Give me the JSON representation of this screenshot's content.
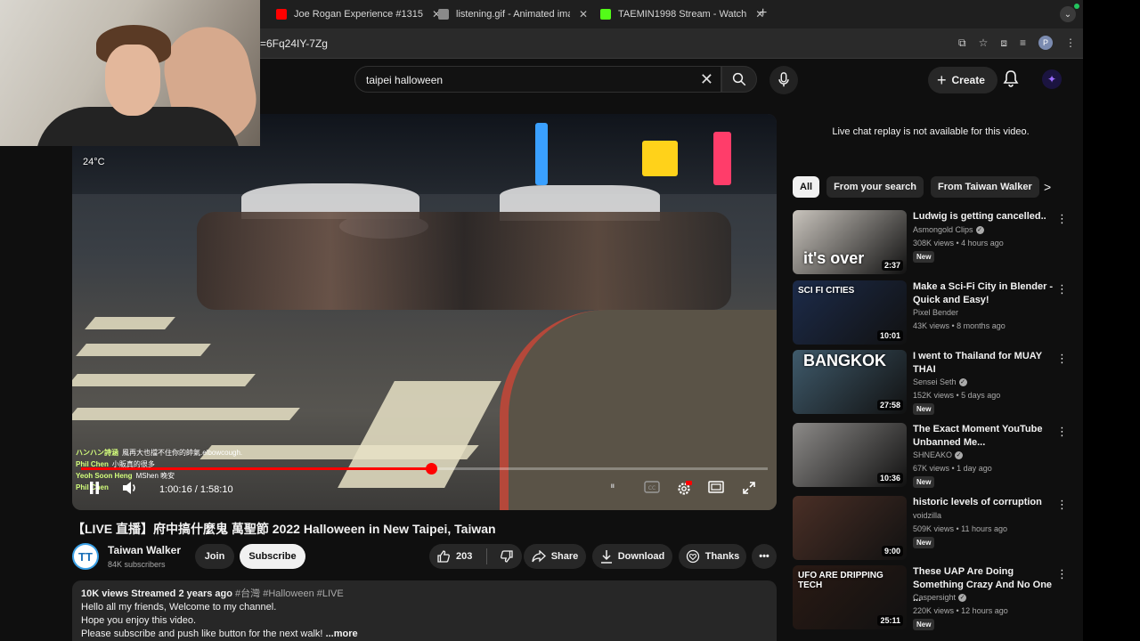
{
  "browser": {
    "tabs": [
      {
        "title": "Joe Rogan Experience #1315",
        "favicon_color": "#ff0000"
      },
      {
        "title": "listening.gif - Animated image",
        "favicon_color": "#8a8a8a"
      },
      {
        "title": "TAEMIN1998 Stream - Watch",
        "favicon_color": "#53fc18"
      }
    ],
    "url": "=6Fq24IY-7Zg",
    "profile_initial": "P"
  },
  "header": {
    "search_query": "taipei halloween",
    "create_label": "Create"
  },
  "player": {
    "temperature": "24°C",
    "current_time": "1:00:16",
    "duration": "1:58:10",
    "progress_fraction": 0.51,
    "chat_overlay": [
      {
        "name": "ハンハン詩涵",
        "message": "風再大也擋不住你的帥氣.elbowcough."
      },
      {
        "name": "Phil Chen",
        "message": "小販真的很多"
      },
      {
        "name": "Yeoh Soon Heng",
        "message": "MShen 晚安"
      },
      {
        "name": "Phil Chen",
        "message": ""
      }
    ]
  },
  "video": {
    "title": "【LIVE 直播】府中搞什麼鬼 萬聖節 2022 Halloween in New Taipei, Taiwan",
    "channel_name": "Taiwan Walker",
    "channel_initial": "TT",
    "subscribers": "84K subscribers",
    "join_label": "Join",
    "subscribe_label": "Subscribe",
    "likes": "203",
    "share_label": "Share",
    "download_label": "Download",
    "thanks_label": "Thanks"
  },
  "description": {
    "meta": "10K views  Streamed 2 years ago",
    "tags": "#台灣 #Halloween #LIVE",
    "line1": "Hello all my friends, Welcome to my channel.",
    "line2": "Hope you enjoy this video.",
    "line3": "Please subscribe and push like button for the next walk! ",
    "more": "...more"
  },
  "sidebar": {
    "live_chat_notice": "Live chat replay is not available for this video.",
    "chips": [
      "All",
      "From your search",
      "From Taiwan Walker"
    ],
    "recommendations": [
      {
        "title": "Ludwig is getting cancelled..",
        "channel": "Asmongold Clips",
        "verified": true,
        "meta": "308K views • 4 hours ago",
        "badge": "New",
        "duration": "2:37",
        "thumb_text": "it's over",
        "thumb_color": "#c9c4bd"
      },
      {
        "title": "Make a Sci-Fi City in Blender - Quick and Easy!",
        "channel": "Pixel Bender",
        "verified": false,
        "meta": "43K views • 8 months ago",
        "badge": "",
        "duration": "10:01",
        "thumb_text": "SCI FI CITIES",
        "thumb_color": "#1c2b4a"
      },
      {
        "title": "I went to Thailand for MUAY THAI",
        "channel": "Sensei Seth",
        "verified": true,
        "meta": "152K views • 5 days ago",
        "badge": "New",
        "duration": "27:58",
        "thumb_text": "BANGKOK",
        "thumb_color": "#3f5a6b"
      },
      {
        "title": "The Exact Moment YouTube Unbanned Me...",
        "channel": "SHNEAKO",
        "verified": true,
        "meta": "67K views • 1 day ago",
        "badge": "New",
        "duration": "10:36",
        "thumb_text": "",
        "thumb_color": "#8c8a88"
      },
      {
        "title": "historic levels of corruption",
        "channel": "voidzilla",
        "verified": false,
        "meta": "509K views • 11 hours ago",
        "badge": "New",
        "duration": "9:00",
        "thumb_text": "",
        "thumb_color": "#4a2f26"
      },
      {
        "title": "These UAP Are Doing Something Crazy And No One ...",
        "channel": "Caspersight",
        "verified": true,
        "meta": "220K views • 12 hours ago",
        "badge": "New",
        "duration": "25:11",
        "thumb_text": "UFO ARE DRIPPING TECH",
        "thumb_color": "#2a1a14"
      }
    ]
  }
}
